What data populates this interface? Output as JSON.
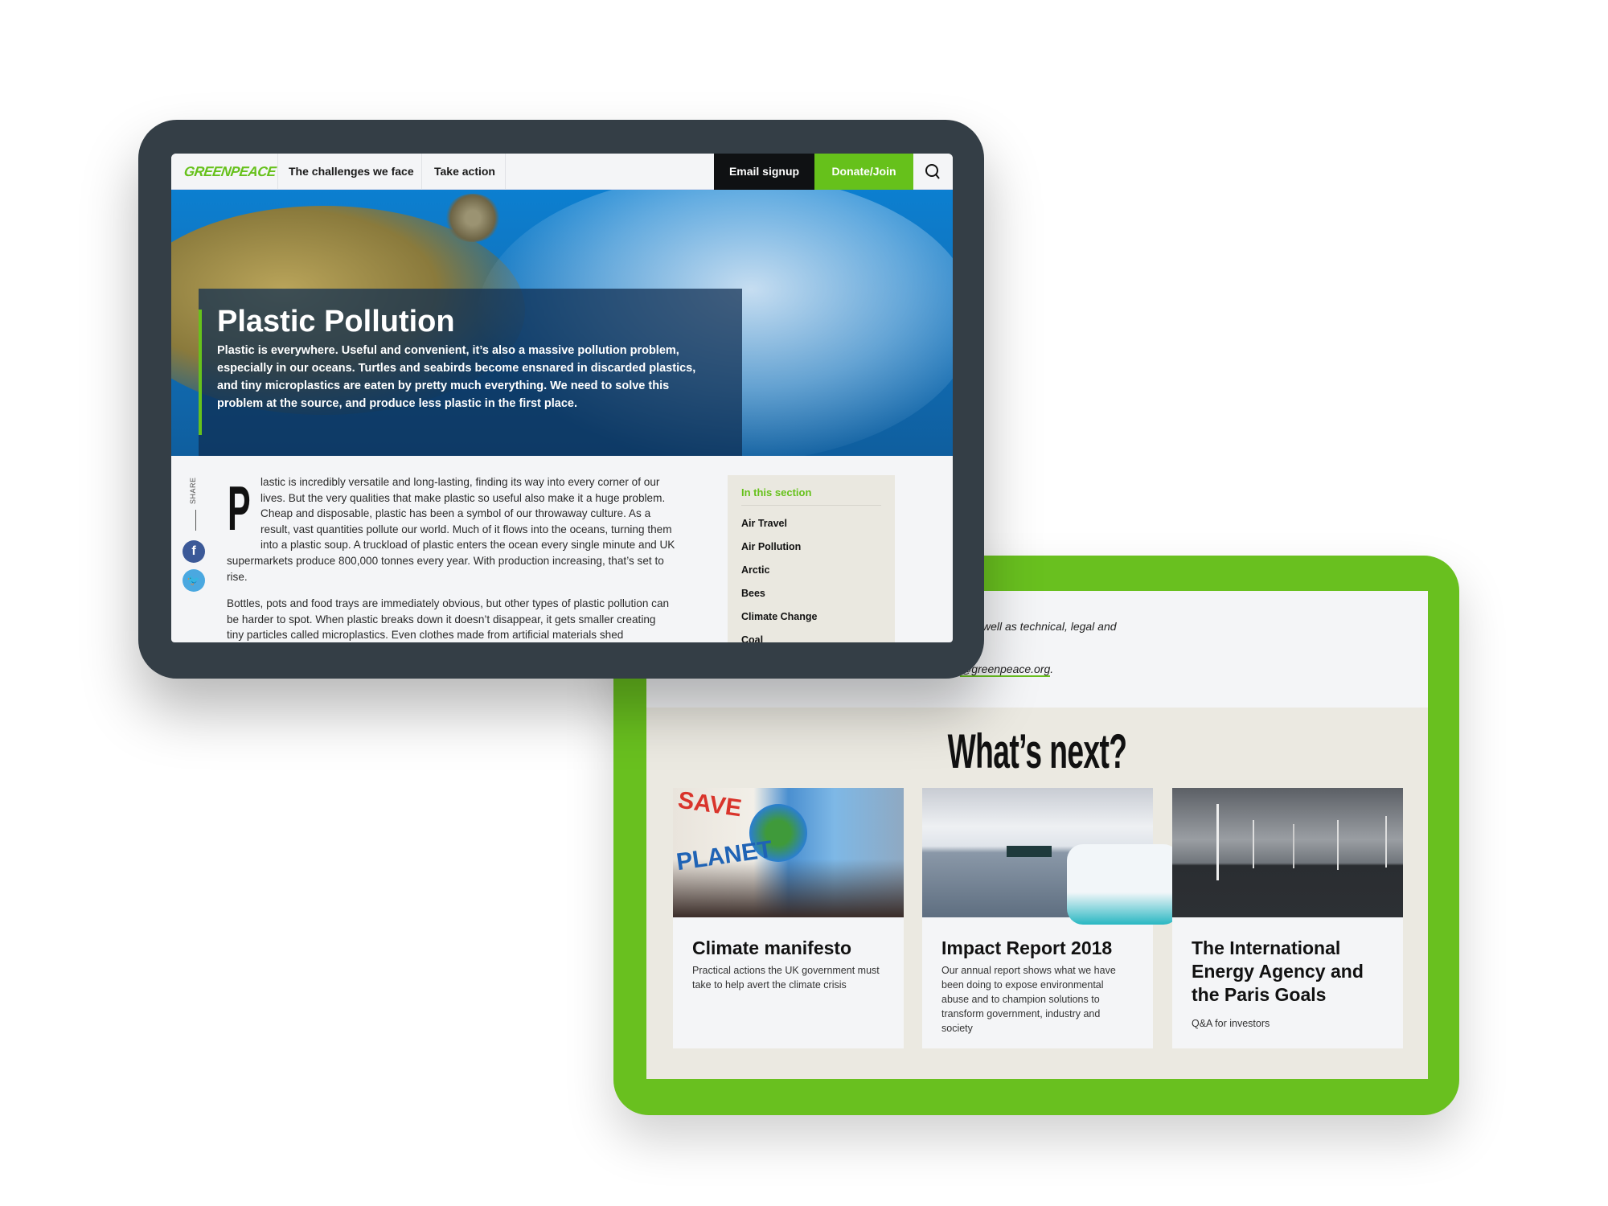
{
  "back_tablet": {
    "text_line1": "well as technical, legal and",
    "text_line2": ".",
    "email_link": "@greenpeace.org",
    "email_suffix": ".",
    "section_title": "What’s next?",
    "cards": [
      {
        "title": "Climate manifesto",
        "description": "Practical actions the UK government must take to help avert the climate crisis"
      },
      {
        "title": "Impact Report 2018",
        "description": "Our annual report shows what we have been doing to expose environmental abuse and to champion solutions to transform government, industry and society"
      },
      {
        "title": "The International Energy Agency and the Paris Goals",
        "description": "Q&A for investors"
      }
    ]
  },
  "nav": {
    "logo": "GREENPEACE",
    "items": [
      "The challenges we face",
      "Take action"
    ],
    "email_signup": "Email signup",
    "donate": "Donate/Join",
    "search_icon": "search-icon"
  },
  "hero": {
    "title": "Plastic Pollution",
    "subtitle": "Plastic is everywhere. Useful and convenient, it’s also a massive pollution problem, especially in our oceans. Turtles and seabirds become ensnared in discarded plastics, and tiny microplastics are eaten by pretty much everything. We need to solve this problem at the source, and produce less plastic in the first place."
  },
  "share": {
    "label": "SHARE",
    "facebook": "f",
    "twitter": "t"
  },
  "article": {
    "drop_cap": "P",
    "p1_first": "lastic is incredibly versatile and long-lasting, finding its way into every corner of our lives. But the very qualities that make plastic so useful also make it a huge problem. Cheap and disposable, plastic has been a symbol of our throwaway culture. As a result, vast quantities pollute our world. Much of it flows into the oceans, turning them into a plastic soup. A truckload of plastic enters the ocean every single minute and UK",
    "p1_rest": "supermarkets produce 800,000 tonnes every year. With production increasing, that’s set to rise.",
    "p2": "Bottles, pots and food trays are immediately obvious, but other types of plastic pollution can be harder to spot. When plastic breaks down it doesn’t disappear, it gets smaller creating tiny particles called microplastics. Even clothes made from artificial materials shed microplastic"
  },
  "sidebar": {
    "title": "In this section",
    "items": [
      "Air Travel",
      "Air Pollution",
      "Arctic",
      "Bees",
      "Climate Change",
      "Coal"
    ]
  },
  "colors": {
    "brand_green": "#66c11b",
    "frame_dark": "#343e46",
    "beige": "#ebe9e1"
  }
}
